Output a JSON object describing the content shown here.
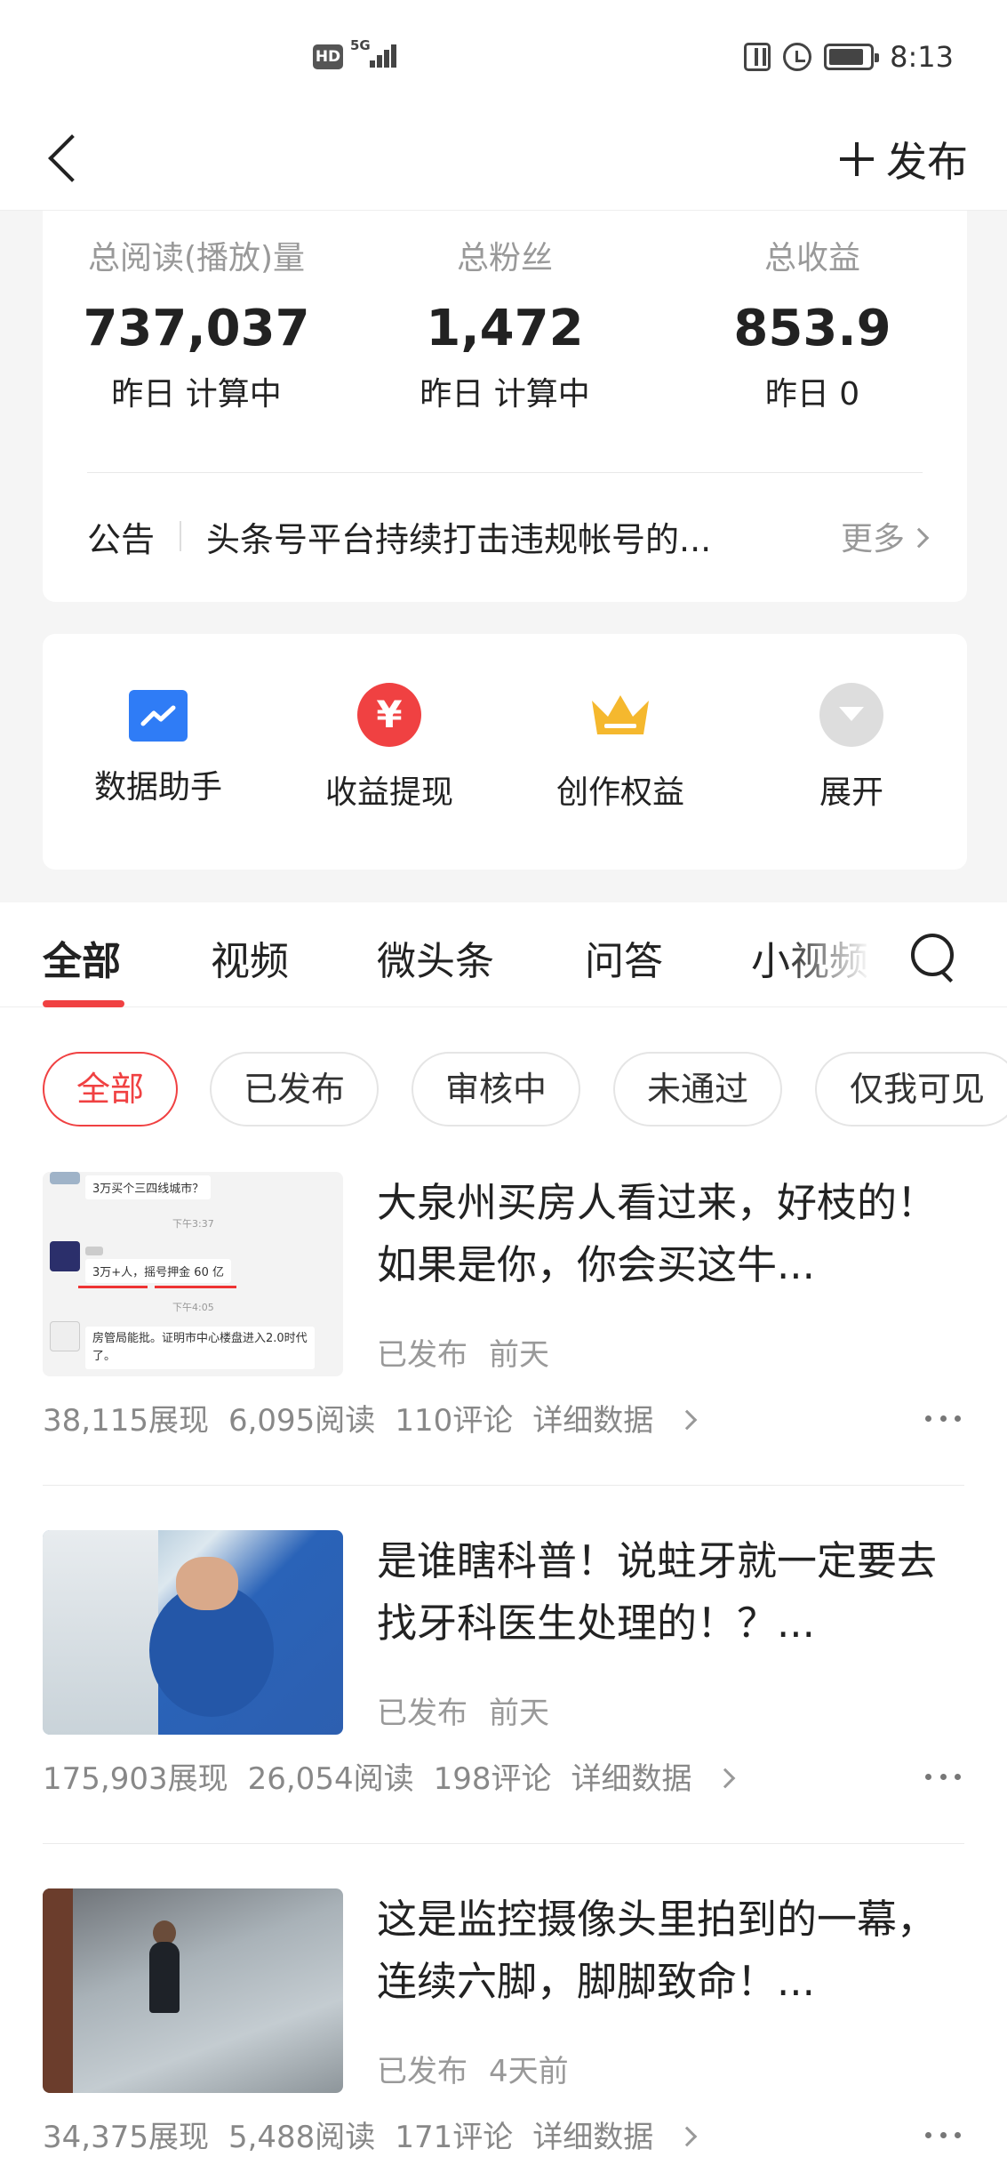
{
  "status_bar": {
    "hd": "HD",
    "network": "5G",
    "time": "8:13"
  },
  "header": {
    "publish_label": "发布"
  },
  "stats": [
    {
      "label": "总阅读(播放)量",
      "value": "737,037",
      "sub": "昨日 计算中"
    },
    {
      "label": "总粉丝",
      "value": "1,472",
      "sub": "昨日 计算中"
    },
    {
      "label": "总收益",
      "value": "853.9",
      "sub": "昨日 0"
    }
  ],
  "notice": {
    "tag": "公告",
    "text": "头条号平台持续打击违规帐号的...",
    "more": "更多"
  },
  "tools": [
    {
      "label": "数据助手",
      "icon": "chart-icon"
    },
    {
      "label": "收益提现",
      "icon": "yuan-icon",
      "glyph": "¥"
    },
    {
      "label": "创作权益",
      "icon": "crown-icon"
    },
    {
      "label": "展开",
      "icon": "expand-icon"
    }
  ],
  "tabs": [
    "全部",
    "视频",
    "微头条",
    "问答",
    "小视频"
  ],
  "filters": [
    "全部",
    "已发布",
    "审核中",
    "未通过",
    "仅我可见"
  ],
  "articles": [
    {
      "title": "大泉州买房人看过来，好枝的！如果是你，你会买这牛...",
      "status": "已发布",
      "time": "前天",
      "impressions": "38,115展现",
      "reads": "6,095阅读",
      "comments": "110评论",
      "detail": "详细数据",
      "thumb_text": {
        "q": "3万买个三四线城市？",
        "t1": "下午3:37",
        "a": "3万+人，摇号押金 60 亿",
        "t2": "下午4:05",
        "c": "房管局能批。证明市中心楼盘进入2.0时代了。"
      }
    },
    {
      "title": "是谁瞎科普！说蛀牙就一定要去找牙科医生处理的！？...",
      "status": "已发布",
      "time": "前天",
      "impressions": "175,903展现",
      "reads": "26,054阅读",
      "comments": "198评论",
      "detail": "详细数据"
    },
    {
      "title": "这是监控摄像头里拍到的一幕，连续六脚，脚脚致命！...",
      "status": "已发布",
      "time": "4天前",
      "impressions": "34,375展现",
      "reads": "5,488阅读",
      "comments": "171评论",
      "detail": "详细数据"
    }
  ],
  "colors": {
    "accent": "#f04142",
    "data_icon": "#2f7cf6",
    "crown": "#f5b82e"
  }
}
